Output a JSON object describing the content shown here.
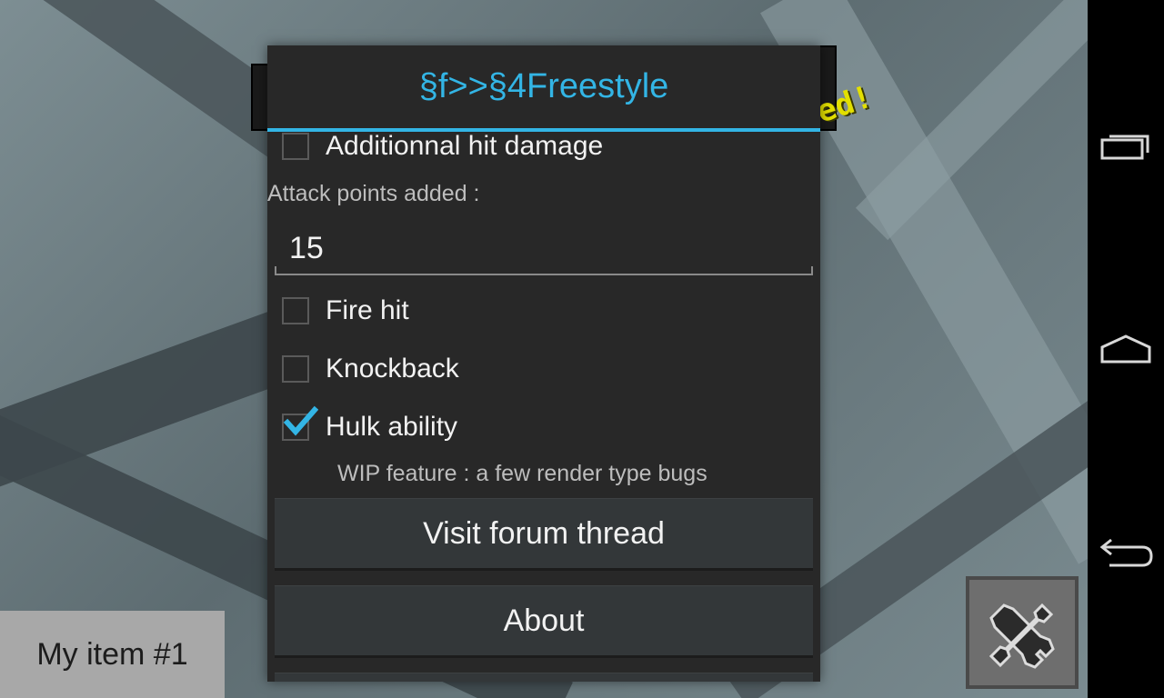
{
  "dialog": {
    "title": "§f>>§4Freestyle",
    "options": [
      {
        "label": "Additionnal hit damage",
        "checked": false
      },
      {
        "label": "Fire hit",
        "checked": false
      },
      {
        "label": "Knockback",
        "checked": false
      },
      {
        "label": "Hulk ability",
        "checked": true
      }
    ],
    "attack_label": "Attack points added :",
    "attack_value": "15",
    "wip_note": "WIP feature : a few render type bugs",
    "buttons": {
      "forum": "Visit forum thread",
      "about": "About"
    }
  },
  "splash_text": "ed!",
  "my_item_label": "My item #1",
  "colors": {
    "accent": "#33b5e5",
    "dialog_bg": "#282828",
    "splash": "#e3e000"
  },
  "icons": {
    "tools": "wrench-screwdriver-icon",
    "recent": "recent-apps-icon",
    "home": "home-icon",
    "back": "back-icon"
  }
}
